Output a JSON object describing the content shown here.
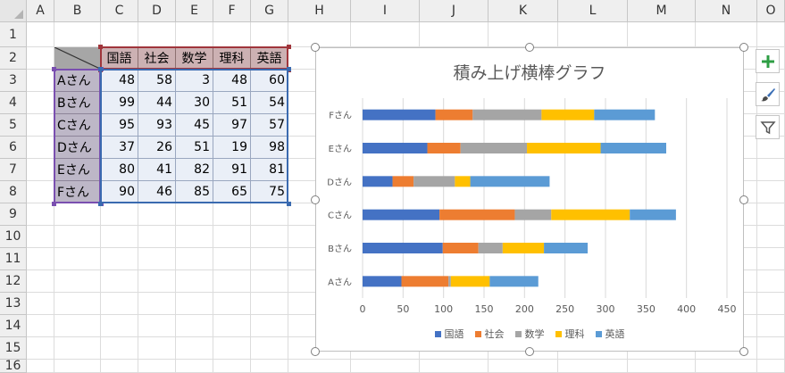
{
  "columns": [
    "A",
    "B",
    "C",
    "D",
    "E",
    "F",
    "G",
    "H",
    "I",
    "J",
    "K",
    "L",
    "M",
    "N",
    "O"
  ],
  "rows": [
    "1",
    "2",
    "3",
    "4",
    "5",
    "6",
    "7",
    "8",
    "9",
    "10",
    "11",
    "12",
    "13",
    "14",
    "15",
    "16"
  ],
  "table": {
    "headers": [
      "国語",
      "社会",
      "数学",
      "理科",
      "英語"
    ],
    "records": [
      {
        "name": "Aさん",
        "scores": [
          "48",
          "58",
          "3",
          "48",
          "60"
        ]
      },
      {
        "name": "Bさん",
        "scores": [
          "99",
          "44",
          "30",
          "51",
          "54"
        ]
      },
      {
        "name": "Cさん",
        "scores": [
          "95",
          "93",
          "45",
          "97",
          "57"
        ]
      },
      {
        "name": "Dさん",
        "scores": [
          "37",
          "26",
          "51",
          "19",
          "98"
        ]
      },
      {
        "name": "Eさん",
        "scores": [
          "80",
          "41",
          "82",
          "91",
          "81"
        ]
      },
      {
        "name": "Fさん",
        "scores": [
          "90",
          "46",
          "85",
          "65",
          "75"
        ]
      }
    ]
  },
  "chart_data": {
    "type": "bar",
    "orientation": "horizontal",
    "stacked": true,
    "title": "積み上げ横棒グラフ",
    "categories": [
      "Aさん",
      "Bさん",
      "Cさん",
      "Dさん",
      "Eさん",
      "Fさん"
    ],
    "series": [
      {
        "name": "国語",
        "color": "#4472c4",
        "values": [
          48,
          99,
          95,
          37,
          80,
          90
        ]
      },
      {
        "name": "社会",
        "color": "#ed7d31",
        "values": [
          58,
          44,
          93,
          26,
          41,
          46
        ]
      },
      {
        "name": "数学",
        "color": "#a5a5a5",
        "values": [
          3,
          30,
          45,
          51,
          82,
          85
        ]
      },
      {
        "name": "理科",
        "color": "#ffc000",
        "values": [
          48,
          51,
          97,
          19,
          91,
          65
        ]
      },
      {
        "name": "英語",
        "color": "#5b9bd5",
        "values": [
          60,
          54,
          57,
          98,
          81,
          75
        ]
      }
    ],
    "xlim": [
      0,
      450
    ],
    "xticks": [
      "0",
      "50",
      "100",
      "150",
      "200",
      "250",
      "300",
      "350",
      "400",
      "450"
    ],
    "grid": true,
    "legend_position": "bottom"
  },
  "side_buttons": [
    {
      "icon": "plus-icon",
      "color": "#2e9e44"
    },
    {
      "icon": "brush-icon",
      "color": "#3b6fb6"
    },
    {
      "icon": "filter-icon",
      "color": "#555555"
    }
  ]
}
